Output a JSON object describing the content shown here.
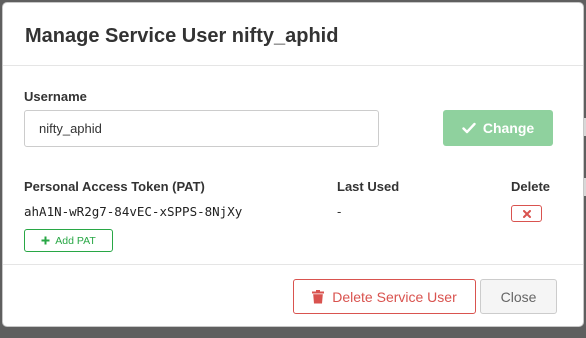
{
  "modal": {
    "title": "Manage Service User nifty_aphid"
  },
  "username": {
    "label": "Username",
    "value": "nifty_aphid",
    "change_label": "Change"
  },
  "pat_table": {
    "headers": {
      "token": "Personal Access Token (PAT)",
      "last_used": "Last Used",
      "delete": "Delete"
    },
    "rows": [
      {
        "token": "ahA1N-wR2g7-84vEC-xSPPS-8NjXy",
        "last_used": "-"
      }
    ],
    "add_label": "Add PAT"
  },
  "footer": {
    "delete_user_label": "Delete Service User",
    "close_label": "Close"
  },
  "colors": {
    "success": "#8fd19e",
    "success_outline": "#28a745",
    "danger": "#d9534f"
  },
  "icons": {
    "change": "check-icon",
    "add_pat": "plus-icon",
    "delete_pat": "times-icon",
    "delete_user": "trash-icon"
  }
}
